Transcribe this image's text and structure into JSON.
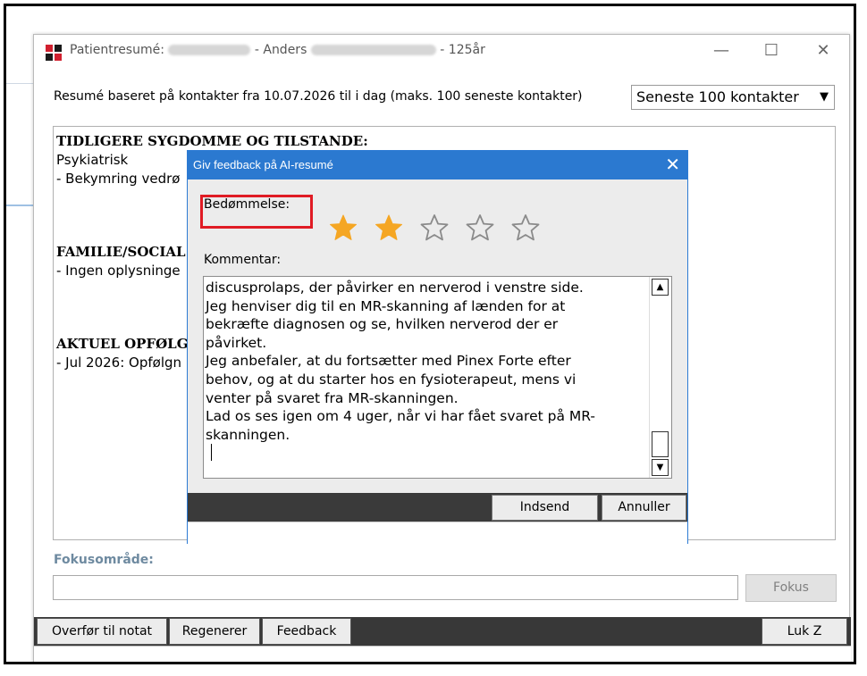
{
  "window": {
    "title_prefix": "Patientresumé:",
    "title_name": "- Anders",
    "title_age": "- 125år",
    "minimize": "—",
    "maximize": "☐",
    "close": "✕"
  },
  "header": {
    "range_text": "Resumé baseret på kontakter fra 10.07.2026 til i dag (maks. 100 seneste kontakter)",
    "select_value": "Seneste 100 kontakter"
  },
  "summary": {
    "sec1_heading": "TIDLIGERE SYGDOMME OG TILSTANDE:",
    "sec1_line1": "Psykiatrisk",
    "sec1_line2": "- Bekymring vedrø",
    "sec2_heading": "FAMILIE/SOCIAL",
    "sec2_line1": "- Ingen oplysninge",
    "sec3_heading": "AKTUEL OPFØLGN",
    "sec3_line1": "- Jul 2026: Opfølgn"
  },
  "focus": {
    "label": "Fokusområde:",
    "value": "",
    "button": "Fokus"
  },
  "bottom_buttons": {
    "transfer": "Overfør til notat",
    "regenerate": "Regenerer",
    "feedback": "Feedback",
    "close": "Luk Z"
  },
  "dialog": {
    "title": "Giv feedback på AI-resumé",
    "close": "✕",
    "rating_label": "Bedømmelse:",
    "rating": 2,
    "rating_max": 5,
    "comment_label": "Kommentar:",
    "comment_text": "discusprolaps, der påvirker en nerverod i venstre side.\nJeg henviser dig til en MR-skanning af lænden for at\nbekræfte diagnosen og se, hvilken nerverod der er\npåvirket.\nJeg anbefaler, at du fortsætter med Pinex Forte efter\nbehov, og at du starter hos en fysioterapeut, mens vi\nventer på svaret fra MR-skanningen.\nLad os ses igen om 4 uger, når vi har fået svaret på MR-\nskanningen.",
    "submit": "Indsend",
    "cancel": "Annuller"
  },
  "colors": {
    "dialog_title_bg": "#2b79d0",
    "star_filled": "#f5a623",
    "highlight_box": "#e01b24",
    "bar_bg": "#383838",
    "focus_label": "#6e8aa0"
  },
  "icons": {
    "star_filled": "star-filled-icon",
    "star_empty": "star-empty-icon",
    "dropdown": "chevron-down-icon",
    "scroll_up": "arrow-up-icon",
    "scroll_down": "arrow-down-icon"
  }
}
